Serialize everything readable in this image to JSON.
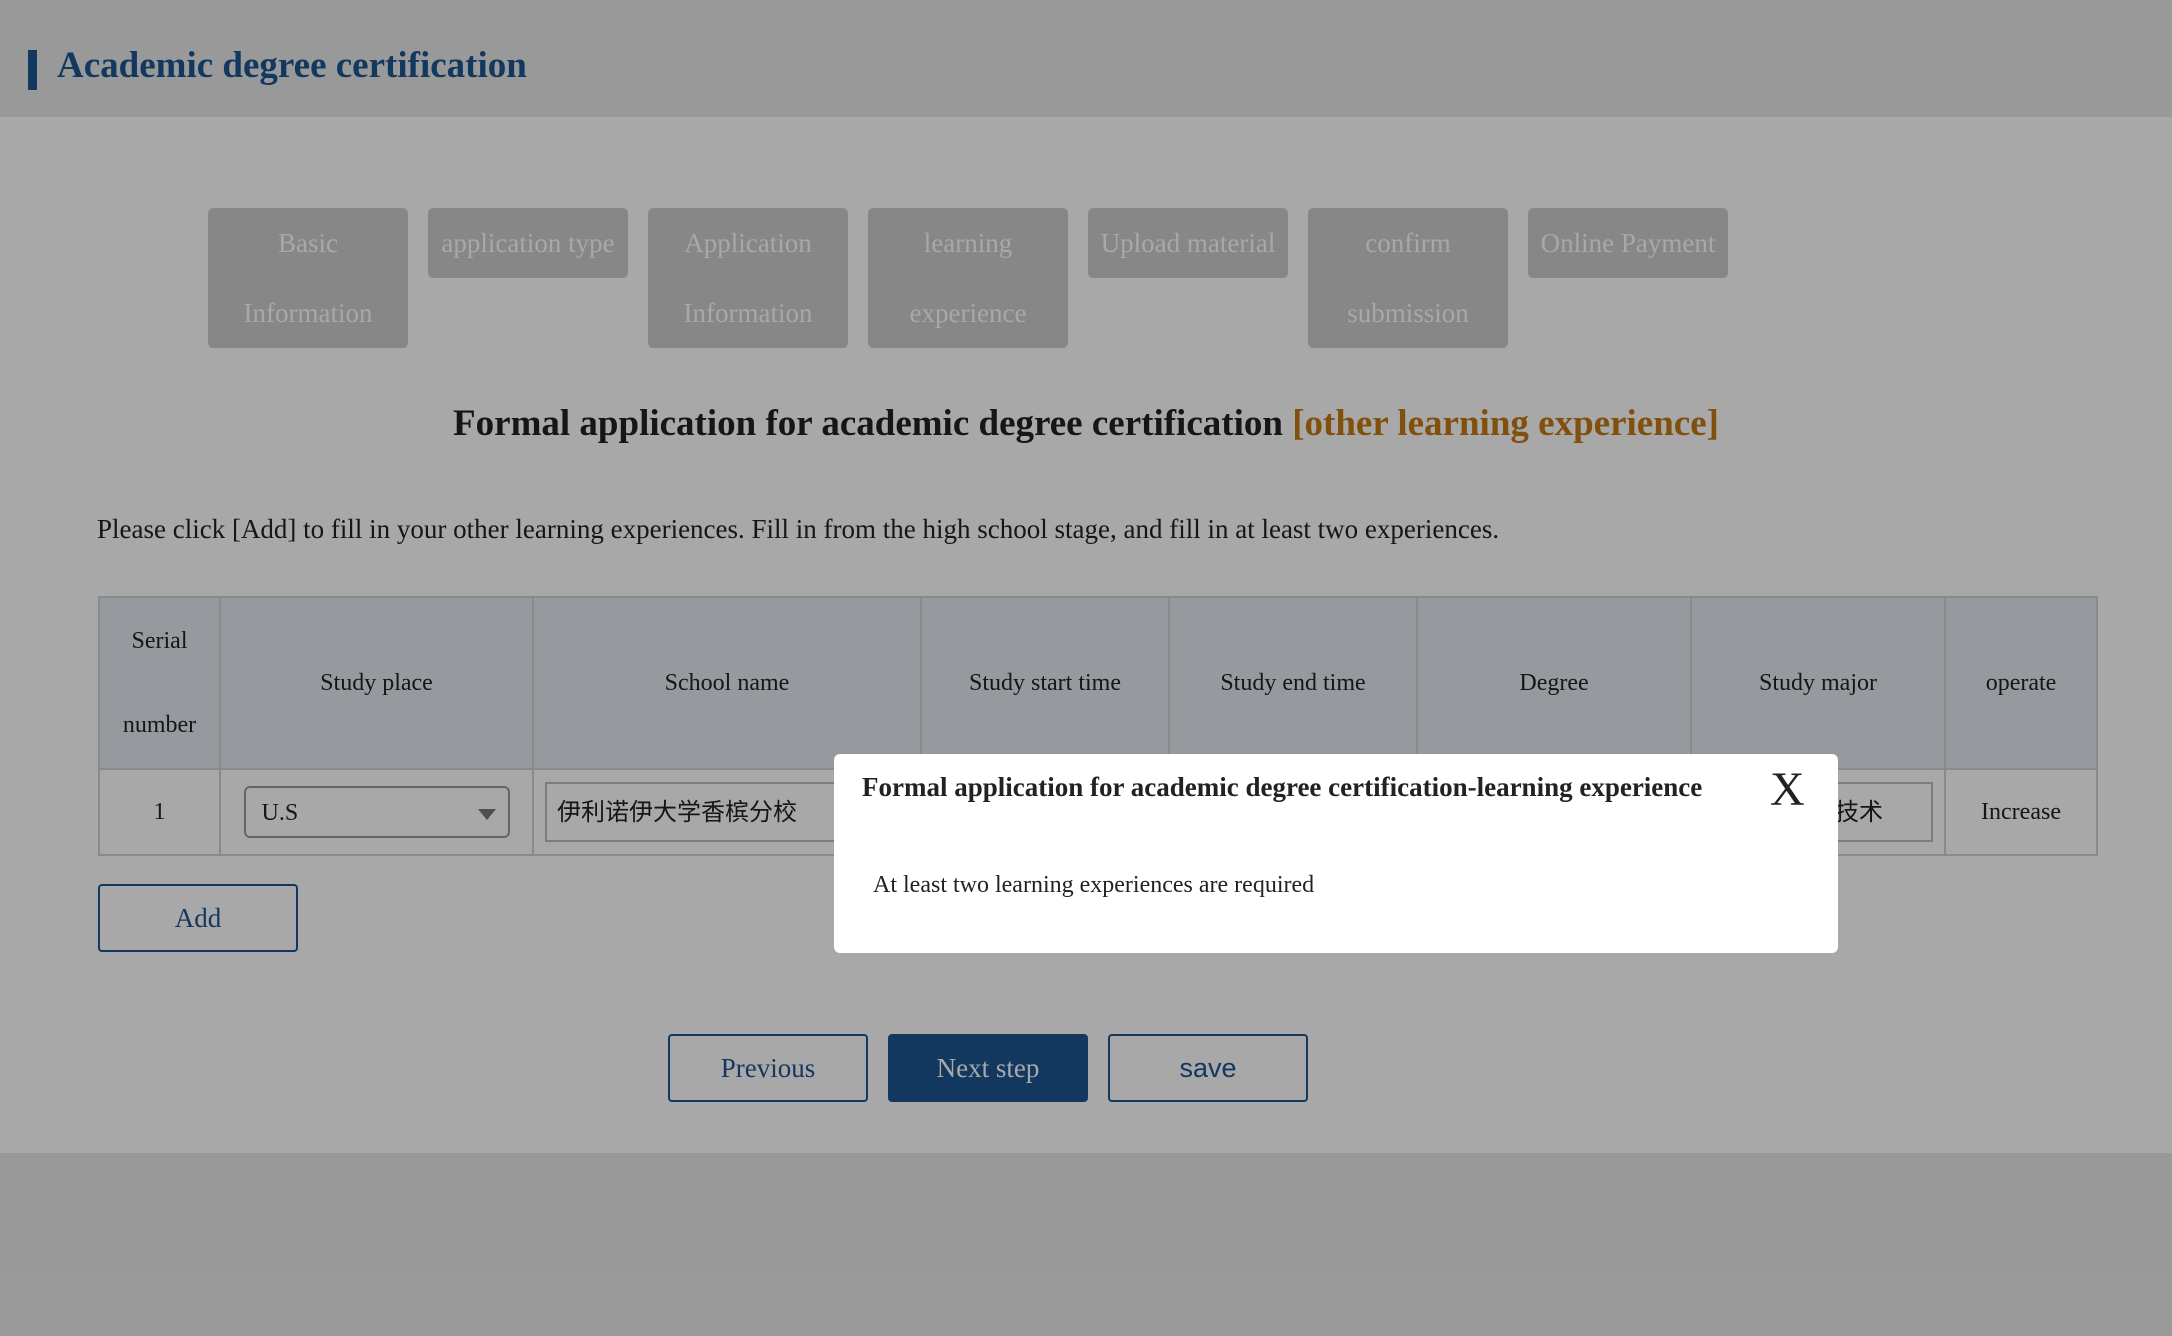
{
  "header": {
    "title": "Academic degree certification"
  },
  "steps": [
    {
      "line1": "Basic",
      "line2": "Information"
    },
    {
      "line1": "application type",
      "line2": ""
    },
    {
      "line1": "Application",
      "line2": "Information"
    },
    {
      "line1": "learning",
      "line2": "experience"
    },
    {
      "line1": "Upload material",
      "line2": ""
    },
    {
      "line1": "confirm",
      "line2": "submission"
    },
    {
      "line1": "Online Payment",
      "line2": ""
    }
  ],
  "heading": {
    "main": "Formal application for academic degree certification ",
    "accent": "[other learning experience]"
  },
  "instruction": "Please click [Add] to fill in your other learning experiences. Fill in from the high school stage, and fill in at least two experiences.",
  "table": {
    "headers": {
      "serial_line1": "Serial",
      "serial_line2": "number",
      "study_place": "Study place",
      "school_name": "School name",
      "start_time": "Study start time",
      "end_time": "Study end time",
      "degree": "Degree",
      "study_major": "Study major",
      "operate": "operate"
    },
    "rows": [
      {
        "serial": "1",
        "study_place": "U.S",
        "school_name": "伊利诺伊大学香槟分校",
        "study_major": "计算机科学技术",
        "operate": "Increase"
      }
    ]
  },
  "buttons": {
    "add": "Add",
    "previous": "Previous",
    "next": "Next step",
    "save": "save"
  },
  "modal": {
    "title": "Formal application for academic degree certification-learning experience",
    "close": "X",
    "message": "At least two learning experiences are required"
  },
  "colors": {
    "brand": "#1c5692",
    "accent": "#c57a14",
    "step_bg": "#cdcdcd",
    "table_header_bg": "#e4eaf2"
  }
}
